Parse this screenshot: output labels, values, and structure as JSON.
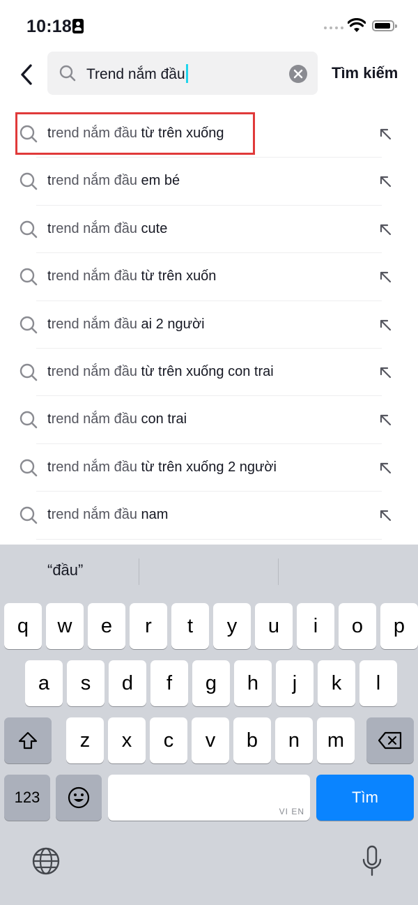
{
  "status_bar": {
    "time": "10:18"
  },
  "search": {
    "query": "Trend nắm đầu",
    "submit_label": "Tìm kiếm"
  },
  "suggestions": [
    {
      "prefix_dark": "t",
      "prefix_light": "rend nắm đầu",
      "rest": " từ trên xuống"
    },
    {
      "prefix_dark": "t",
      "prefix_light": "rend nắm đầu",
      "rest": " em bé"
    },
    {
      "prefix_dark": "t",
      "prefix_light": "rend nắm đầu",
      "rest": " cute"
    },
    {
      "prefix_dark": "t",
      "prefix_light": "rend nắm đầu",
      "rest": " từ trên xuốn"
    },
    {
      "prefix_dark": "t",
      "prefix_light": "rend nắm đầu",
      "rest": " ai 2 người"
    },
    {
      "prefix_dark": "t",
      "prefix_light": "rend nắm đầu",
      "rest": " từ trên xuống con trai"
    },
    {
      "prefix_dark": "t",
      "prefix_light": "rend nắm đầu",
      "rest": " con trai"
    },
    {
      "prefix_dark": "t",
      "prefix_light": "rend nắm đầu",
      "rest": " từ trên xuống 2 người"
    },
    {
      "prefix_dark": "t",
      "prefix_light": "rend nắm đầu",
      "rest": " nam"
    }
  ],
  "keyboard": {
    "prediction": "“đầu”",
    "row1": [
      "q",
      "w",
      "e",
      "r",
      "t",
      "y",
      "u",
      "i",
      "o",
      "p"
    ],
    "row2": [
      "a",
      "s",
      "d",
      "f",
      "g",
      "h",
      "j",
      "k",
      "l"
    ],
    "row3": [
      "z",
      "x",
      "c",
      "v",
      "b",
      "n",
      "m"
    ],
    "numbers_label": "123",
    "space_sub_label": "VI EN",
    "return_label": "Tìm"
  },
  "colors": {
    "accent_caret": "#20d5ec",
    "return_key": "#0a84ff",
    "highlight": "#e03a3a"
  }
}
